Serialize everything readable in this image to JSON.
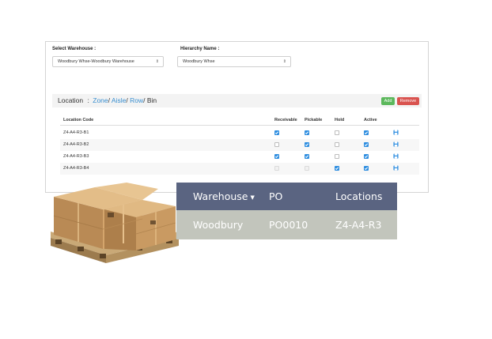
{
  "form": {
    "warehouse_label": "Select Warehouse :",
    "warehouse_value": "Woodbury Whse-Woodbury Warehouse",
    "hierarchy_label": "Hierarchy Name :",
    "hierarchy_value": "Woodbury Whse"
  },
  "breadcrumb": {
    "prefix": "Location",
    "sep": ":",
    "zone": "Zone",
    "aisle": "Aisle",
    "row": "Row",
    "bin": "Bin",
    "slash": "/"
  },
  "actions": {
    "add_label": "Add",
    "remove_label": "Remove"
  },
  "grid": {
    "headers": [
      "Location Code",
      "Receivable",
      "Pickable",
      "Hold",
      "Active"
    ],
    "rows": [
      {
        "code": "Z4-A4-R3-B1",
        "receivable": "checked",
        "pickable": "checked",
        "hold": "unchecked",
        "active": "checked"
      },
      {
        "code": "Z4-A4-R3-B2",
        "receivable": "unchecked",
        "pickable": "checked",
        "hold": "unchecked",
        "active": "checked"
      },
      {
        "code": "Z4-A4-R3-B3",
        "receivable": "checked",
        "pickable": "checked",
        "hold": "unchecked",
        "active": "checked"
      },
      {
        "code": "Z4-A4-R3-B4",
        "receivable": "disabled",
        "pickable": "disabled",
        "hold": "checked",
        "active": "checked"
      }
    ]
  },
  "summary": {
    "headers": {
      "warehouse": "Warehouse",
      "po": "PO",
      "locations": "Locations"
    },
    "row": {
      "warehouse": "Woodbury",
      "po": "PO0010",
      "locations": "Z4-A4-R3"
    }
  },
  "icons": {
    "caret": "chevron-updown-icon",
    "save": "floppy-disk-icon",
    "sort": "caret-down-icon"
  },
  "colors": {
    "link": "#3a8fd0",
    "checkbox": "#2f8ee0",
    "add": "#5cb85c",
    "remove": "#d9534f",
    "table_header": "#5a6481",
    "table_body": "#c2c5bc"
  }
}
